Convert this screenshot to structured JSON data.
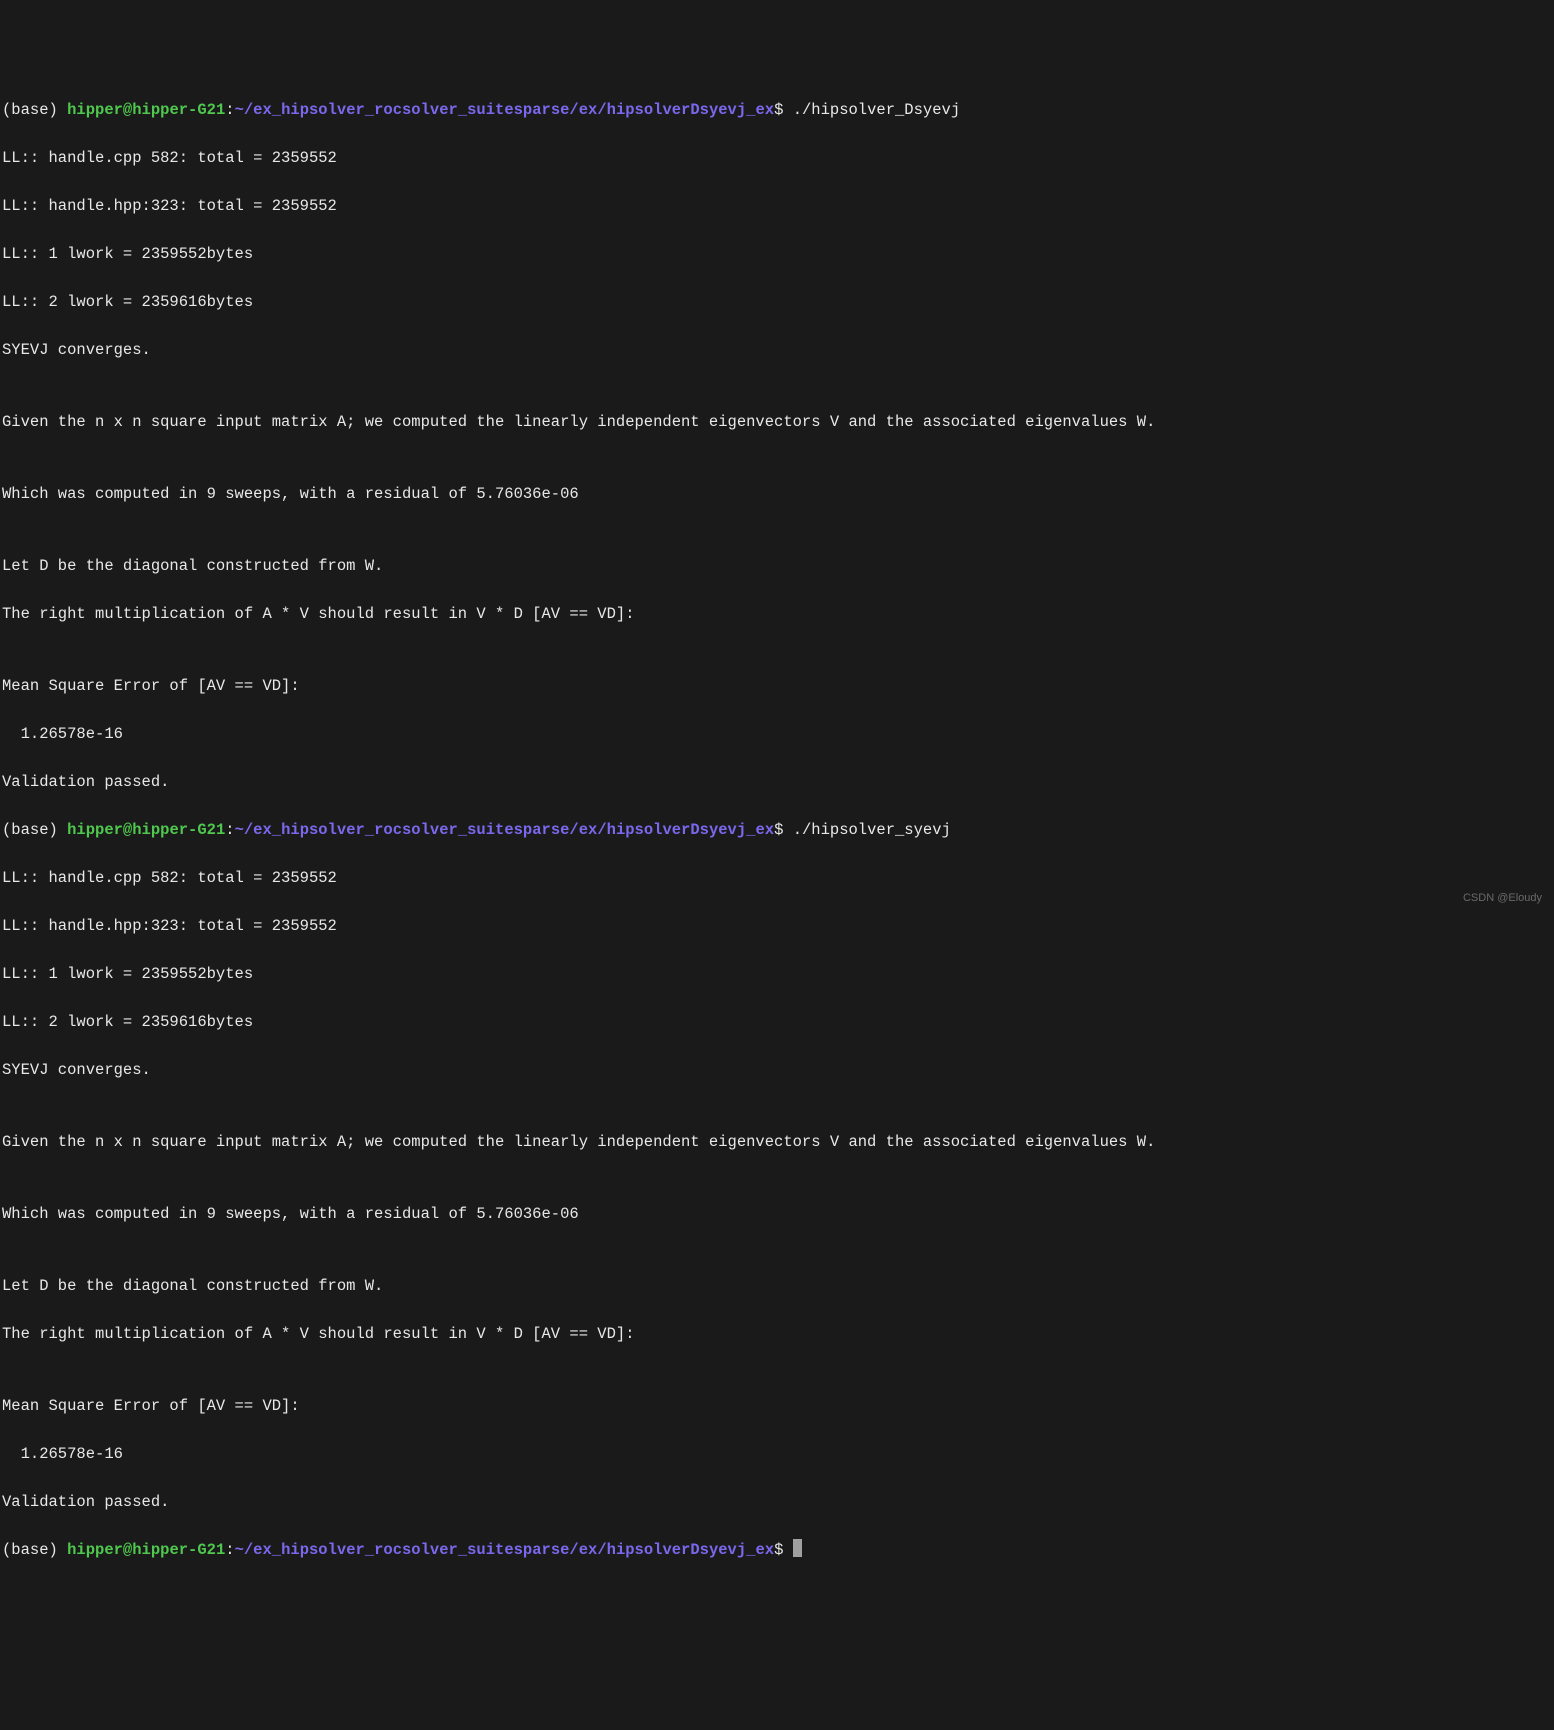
{
  "prompt1": {
    "env": "(base) ",
    "user": "hipper@hipper-G21",
    "sep": ":",
    "path": "~/ex_hipsolver_rocsolver_suitesparse/ex/hipsolverDsyevj_ex",
    "dollar": "$",
    "command": " ./hipsolver_Dsyevj"
  },
  "out1": {
    "l1": "LL:: handle.cpp 582: total = 2359552",
    "l2": "LL:: handle.hpp:323: total = 2359552",
    "l3": "LL:: 1 lwork = 2359552bytes",
    "l4": "LL:: 2 lwork = 2359616bytes",
    "l5": "SYEVJ converges.",
    "l6": "",
    "l7": "Given the n x n square input matrix A; we computed the linearly independent eigenvectors V and the associated eigenvalues W.",
    "l8": "",
    "l9": "Which was computed in 9 sweeps, with a residual of 5.76036e-06",
    "l10": "",
    "l11": "Let D be the diagonal constructed from W.",
    "l12": "The right multiplication of A * V should result in V * D [AV == VD]:",
    "l13": "",
    "l14": "Mean Square Error of [AV == VD]:",
    "l15": "  1.26578e-16",
    "l16": "Validation passed."
  },
  "prompt2": {
    "env": "(base) ",
    "user": "hipper@hipper-G21",
    "sep": ":",
    "path": "~/ex_hipsolver_rocsolver_suitesparse/ex/hipsolverDsyevj_ex",
    "dollar": "$",
    "command": " ./hipsolver_syevj"
  },
  "out2": {
    "l1": "LL:: handle.cpp 582: total = 2359552",
    "l2": "LL:: handle.hpp:323: total = 2359552",
    "l3": "LL:: 1 lwork = 2359552bytes",
    "l4": "LL:: 2 lwork = 2359616bytes",
    "l5": "SYEVJ converges.",
    "l6": "",
    "l7": "Given the n x n square input matrix A; we computed the linearly independent eigenvectors V and the associated eigenvalues W.",
    "l8": "",
    "l9": "Which was computed in 9 sweeps, with a residual of 5.76036e-06",
    "l10": "",
    "l11": "Let D be the diagonal constructed from W.",
    "l12": "The right multiplication of A * V should result in V * D [AV == VD]:",
    "l13": "",
    "l14": "Mean Square Error of [AV == VD]:",
    "l15": "  1.26578e-16",
    "l16": "Validation passed."
  },
  "prompt3": {
    "env": "(base) ",
    "user": "hipper@hipper-G21",
    "sep": ":",
    "path": "~/ex_hipsolver_rocsolver_suitesparse/ex/hipsolverDsyevj_ex",
    "dollar": "$",
    "command": " "
  },
  "watermark": "CSDN @Eloudy"
}
